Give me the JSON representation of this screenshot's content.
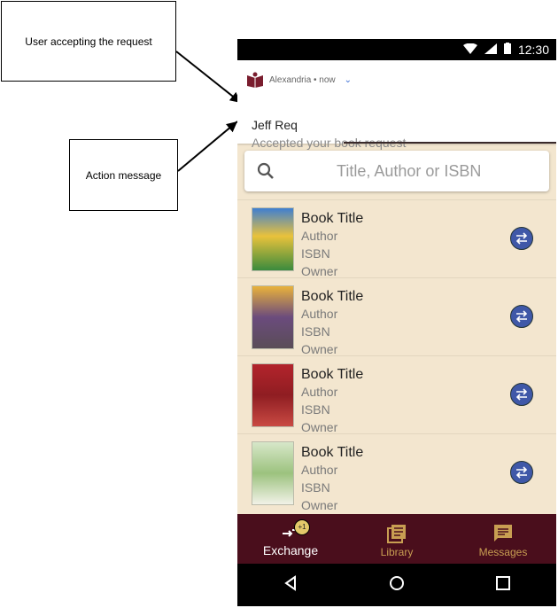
{
  "callouts": {
    "user_accepting": "User accepting the request",
    "action_message": "Action message"
  },
  "status_bar": {
    "time": "12:30"
  },
  "notification": {
    "app_name": "Alexandria • now",
    "title": "Jeff Req",
    "text": "Accepted your book request",
    "icon": "book-app-icon"
  },
  "search": {
    "placeholder": "Title, Author or ISBN",
    "icon": "search-icon"
  },
  "books": [
    {
      "title": "Book Title",
      "author": "Author",
      "isbn": "ISBN",
      "owner": "Owner",
      "cover_color": "#3f7fd1"
    },
    {
      "title": "Book Title",
      "author": "Author",
      "isbn": "ISBN",
      "owner": "Owner",
      "cover_color": "#6b4b7d"
    },
    {
      "title": "Book Title",
      "author": "Author",
      "isbn": "ISBN",
      "owner": "Owner",
      "cover_color": "#b3242c"
    },
    {
      "title": "Book Title",
      "author": "Author",
      "isbn": "ISBN",
      "owner": "Owner",
      "cover_color": "#d7e7c9"
    }
  ],
  "bottom_nav": [
    {
      "label": "Exchange",
      "badge": "+1",
      "icon": "exchange-icon",
      "active": true
    },
    {
      "label": "Library",
      "icon": "library-icon"
    },
    {
      "label": "Messages",
      "icon": "messages-icon"
    }
  ],
  "colors": {
    "primary": "#4a0e1c",
    "accent": "#c89e52",
    "background": "#f3e6cf",
    "exchange_button": "#3f58a8"
  }
}
